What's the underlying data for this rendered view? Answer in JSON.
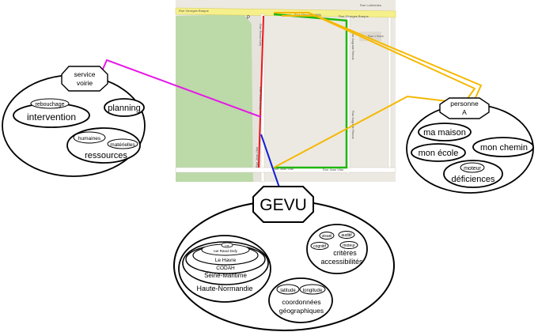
{
  "map": {
    "streets": {
      "top_left": "Rue Georges Braque",
      "top_mid": "Rue Maurice Utrillo",
      "top_right": "Rue Georges Braque",
      "top_far": "Rue Lurlinedeu",
      "left_vertical": "Rue Raoul Dufy",
      "mid_vertical": "Rue Raoul Dufy",
      "right_vertical": "Rue Auguste Renoir",
      "right_vertical2": "Rue Auguste Renoir",
      "bottom_left": "Rue Jean Vilar",
      "bottom_right": "Rue Jean Vilar",
      "corner_left": "Rue Jean Vilar",
      "poi": "Rue L'Eure",
      "marker": "P"
    },
    "colors": {
      "segment_red": "#e8161b",
      "segment_green": "#1fb80f",
      "road_yellow": "#f6f08a"
    }
  },
  "nodes": {
    "service_voirie": {
      "line1": "service",
      "line2": "voirie"
    },
    "personne_a": {
      "line1": "personne",
      "line2": "A"
    },
    "gevu": {
      "label": "GEVU"
    }
  },
  "service_group": {
    "intervention": "intervention",
    "rebouchage": "rebouchage",
    "planning": "planning",
    "ressources": "ressources",
    "humaines": "humaines",
    "materielles": "matérielles"
  },
  "person_group": {
    "ma_maison": "ma maison",
    "mon_ecole": "mon école",
    "mon_chemin": "mon chemin",
    "deficiences": "déficiences",
    "moteur": "moteur"
  },
  "gevu_group": {
    "rue": "rue",
    "rue_raoul_dufy": "rue Raoul Dufy",
    "le_havre": "Le Havre",
    "codah": "CODAH",
    "seine_maritime": "Seine-Maritime",
    "haute_normandie": "Haute-Normandie",
    "visuel": "visuel",
    "auditif": "auditif",
    "cognitif": "cognitif",
    "moteur": "moteur",
    "criteres": "critères",
    "accessibilites": "accessibilités",
    "latitude": "latitude",
    "longitude": "longitude",
    "coordonnees": "coordonnées",
    "geographiques": "géographiques"
  },
  "colors": {
    "service_link": "#e619e6",
    "person_link": "#f5b800",
    "gevu_link": "#1020d8",
    "map_bg": "#ece9e2",
    "park": "#bcd9a8"
  }
}
